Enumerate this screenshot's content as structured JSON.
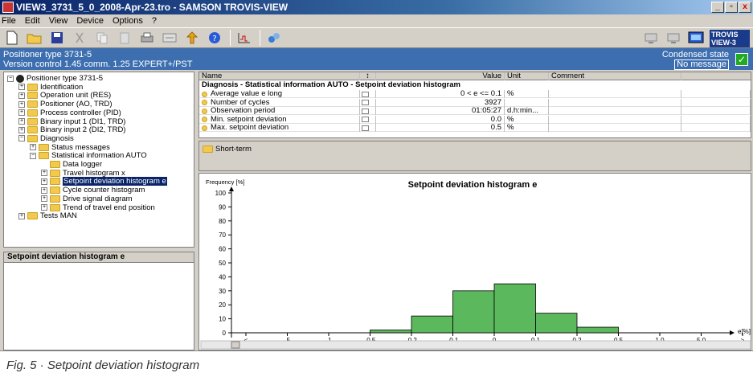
{
  "window": {
    "title": "VIEW3_3731_5_0_2008-Apr-23.tro - SAMSON TROVIS-VIEW",
    "controls": [
      "_",
      "▫",
      "x"
    ]
  },
  "menu": [
    "File",
    "Edit",
    "View",
    "Device",
    "Options",
    "?"
  ],
  "toolbar": {
    "icons": [
      "new-icon",
      "open-icon",
      "save-icon",
      "cut-icon",
      "copy-icon",
      "paste-icon",
      "print-icon",
      "properties-icon",
      "upload-icon",
      "help-icon",
      "chart-icon",
      "connect-icon"
    ],
    "logo_text": [
      "TROVIS",
      "VIEW-3"
    ]
  },
  "info": {
    "device": "Positioner type 3731-5",
    "version": "Version control 1.45   comm. 1.25   EXPERT+/PST",
    "state_label": "Condensed state",
    "state_value": "No message"
  },
  "tree": [
    {
      "label": "Positioner type 3731-5",
      "level": 0,
      "exp": "−",
      "icon": "device"
    },
    {
      "label": "Identification",
      "level": 1,
      "exp": "+",
      "icon": "folder"
    },
    {
      "label": "Operation unit (RES)",
      "level": 1,
      "exp": "+",
      "icon": "folder"
    },
    {
      "label": "Positioner (AO, TRD)",
      "level": 1,
      "exp": "+",
      "icon": "folder"
    },
    {
      "label": "Process controller (PID)",
      "level": 1,
      "exp": "+",
      "icon": "folder"
    },
    {
      "label": "Binary input 1 (DI1, TRD)",
      "level": 1,
      "exp": "+",
      "icon": "folder"
    },
    {
      "label": "Binary input 2 (DI2, TRD)",
      "level": 1,
      "exp": "+",
      "icon": "folder"
    },
    {
      "label": "Diagnosis",
      "level": 1,
      "exp": "−",
      "icon": "folder"
    },
    {
      "label": "Status messages",
      "level": 2,
      "exp": "+",
      "icon": "folder"
    },
    {
      "label": "Statistical information AUTO",
      "level": 2,
      "exp": "−",
      "icon": "folder"
    },
    {
      "label": "Data logger",
      "level": 3,
      "exp": "",
      "icon": "folder"
    },
    {
      "label": "Travel histogram x",
      "level": 3,
      "exp": "+",
      "icon": "folder"
    },
    {
      "label": "Setpoint deviation histogram e",
      "level": 3,
      "exp": "+",
      "icon": "folder",
      "selected": true
    },
    {
      "label": "Cycle counter histogram",
      "level": 3,
      "exp": "+",
      "icon": "folder"
    },
    {
      "label": "Drive signal diagram",
      "level": 3,
      "exp": "+",
      "icon": "folder"
    },
    {
      "label": "Trend of travel end position",
      "level": 3,
      "exp": "+",
      "icon": "folder"
    },
    {
      "label": "Tests MAN",
      "level": 1,
      "exp": "+",
      "icon": "folder"
    }
  ],
  "bottom_panel_title": "Setpoint deviation histogram e",
  "table": {
    "headers": {
      "name": "Name",
      "value": "Value",
      "unit": "Unit",
      "comment": "Comment"
    },
    "section": "Diagnosis - Statistical information AUTO - Setpoint deviation histogram",
    "rows": [
      {
        "name": "Average value e long",
        "value": "0 < e  <= 0.1",
        "unit": "%"
      },
      {
        "name": "Number of cycles",
        "value": "3927",
        "unit": ""
      },
      {
        "name": "Observation period",
        "value": "01:05:27",
        "unit": "d.h:min..."
      },
      {
        "name": "Min. setpoint deviation",
        "value": "0.0",
        "unit": "%"
      },
      {
        "name": "Max. setpoint deviation",
        "value": "0.5",
        "unit": "%"
      }
    ],
    "short_term": "Short-term"
  },
  "chart_data": {
    "type": "bar",
    "title": "Setpoint deviation histogram e",
    "ylabel": "Frequency [%]",
    "xlabel": "e[%]",
    "ylim": [
      0,
      100
    ],
    "yticks": [
      0,
      10,
      20,
      30,
      40,
      50,
      60,
      70,
      80,
      90,
      100
    ],
    "categories": [
      "<",
      "-5",
      "-1",
      "-0.5",
      "-0.2",
      "-0.1",
      "0",
      "0.1",
      "0.2",
      "0.5",
      "1.0",
      "5.0",
      ">"
    ],
    "values": [
      0,
      0,
      0,
      2,
      12,
      30,
      35,
      14,
      4,
      0,
      0,
      0
    ],
    "bar_color": "#5cb85c"
  },
  "caption": "Fig. 5 · Setpoint deviation histogram"
}
